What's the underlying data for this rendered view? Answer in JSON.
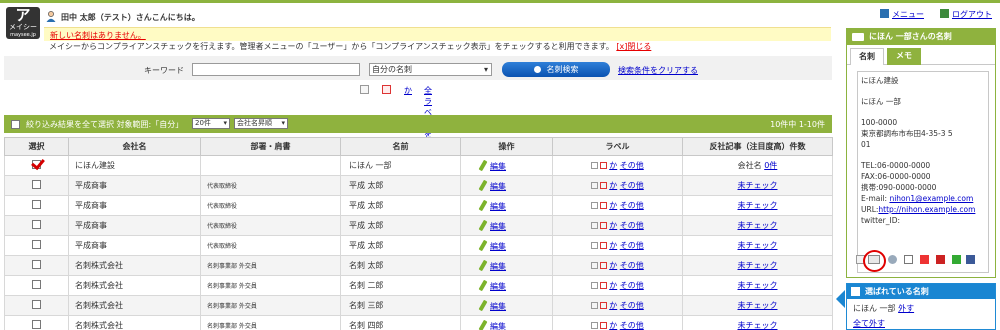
{
  "header": {
    "logo_line1": "ア",
    "logo_line2": "メイシー",
    "logo_line3": "maysee.jp",
    "greeting": "田中 太郎（テスト）さんこんにちは。",
    "menu_label": "メニュー",
    "logout_label": "ログアウト"
  },
  "notice": {
    "text": "新しい名刺はありません。",
    "info": "メイシーからコンプライアンスチェックを行えます。管理者メニューの「ユーザー」から「コンプライアンスチェック表示」をチェックすると利用できます。",
    "close_label": "[x]閉じる"
  },
  "search": {
    "keyword_label": "キーワード",
    "keyword_value": "",
    "scope_selected": "自分の名刺",
    "search_button": "名刺検索",
    "clear_link": "検索条件をクリアする"
  },
  "label_tools": {
    "kana_link": "か",
    "all_labels_link": "全ラベルを見る"
  },
  "list": {
    "filter_text": "絞り込み結果を全て選択 対象範囲:「自分」",
    "per_page": "20件",
    "sort_order": "会社名昇順",
    "count": "10件中 1-10件",
    "columns": [
      "選択",
      "会社名",
      "部署・肩書",
      "名前",
      "操作",
      "ラベル",
      "反社記事（注目度高）件数"
    ],
    "edit_label": "編集",
    "kana_label": "か",
    "other_label": "その他",
    "rows": [
      {
        "selected": true,
        "company": "にほん建設",
        "title": "",
        "name": "にほん 一部",
        "news_prefix": "会社名",
        "news": "0件"
      },
      {
        "selected": false,
        "company": "平成商事",
        "title": "代表取締役",
        "name": "平成 太郎",
        "news_prefix": "",
        "news": "未チェック"
      },
      {
        "selected": false,
        "company": "平成商事",
        "title": "代表取締役",
        "name": "平成 太郎",
        "news_prefix": "",
        "news": "未チェック"
      },
      {
        "selected": false,
        "company": "平成商事",
        "title": "代表取締役",
        "name": "平成 太郎",
        "news_prefix": "",
        "news": "未チェック"
      },
      {
        "selected": false,
        "company": "平成商事",
        "title": "代表取締役",
        "name": "平成 太郎",
        "news_prefix": "",
        "news": "未チェック"
      },
      {
        "selected": false,
        "company": "名刺株式会社",
        "title": "名刺事業部 外交員",
        "name": "名刺 太郎",
        "news_prefix": "",
        "news": "未チェック"
      },
      {
        "selected": false,
        "company": "名刺株式会社",
        "title": "名刺事業部 外交員",
        "name": "名刺 二郎",
        "news_prefix": "",
        "news": "未チェック"
      },
      {
        "selected": false,
        "company": "名刺株式会社",
        "title": "名刺事業部 外交員",
        "name": "名刺 三郎",
        "news_prefix": "",
        "news": "未チェック"
      },
      {
        "selected": false,
        "company": "名刺株式会社",
        "title": "名刺事業部 外交員",
        "name": "名刺 四郎",
        "news_prefix": "",
        "news": "未チェック"
      }
    ]
  },
  "side_panel": {
    "title": "にほん 一部さんの名刺",
    "tab_card": "名刺",
    "tab_memo": "メモ",
    "company": "にほん建設",
    "person": "にほん 一部",
    "postal": "100-0000",
    "address1": "東京都調布市布田4-35-3 5",
    "address2": "01",
    "tel": "TEL:06-0000-0000",
    "fax": "FAX:06-0000-0000",
    "mobile": "携帯:090-0000-0000",
    "email_label": "E-mail: ",
    "email": "nihon1@example.com",
    "url_label": "URL:",
    "url": "http://nihon.example.com",
    "twitter": "twitter_ID:"
  },
  "selected_panel": {
    "title": "選ばれている名刺",
    "name": "にほん 一部",
    "remove_link": "外す",
    "clear_all": "全て外す"
  },
  "colors": {
    "accent_green": "#8fb23e",
    "accent_blue": "#1a86d2",
    "highlight_red": "#e00000"
  }
}
